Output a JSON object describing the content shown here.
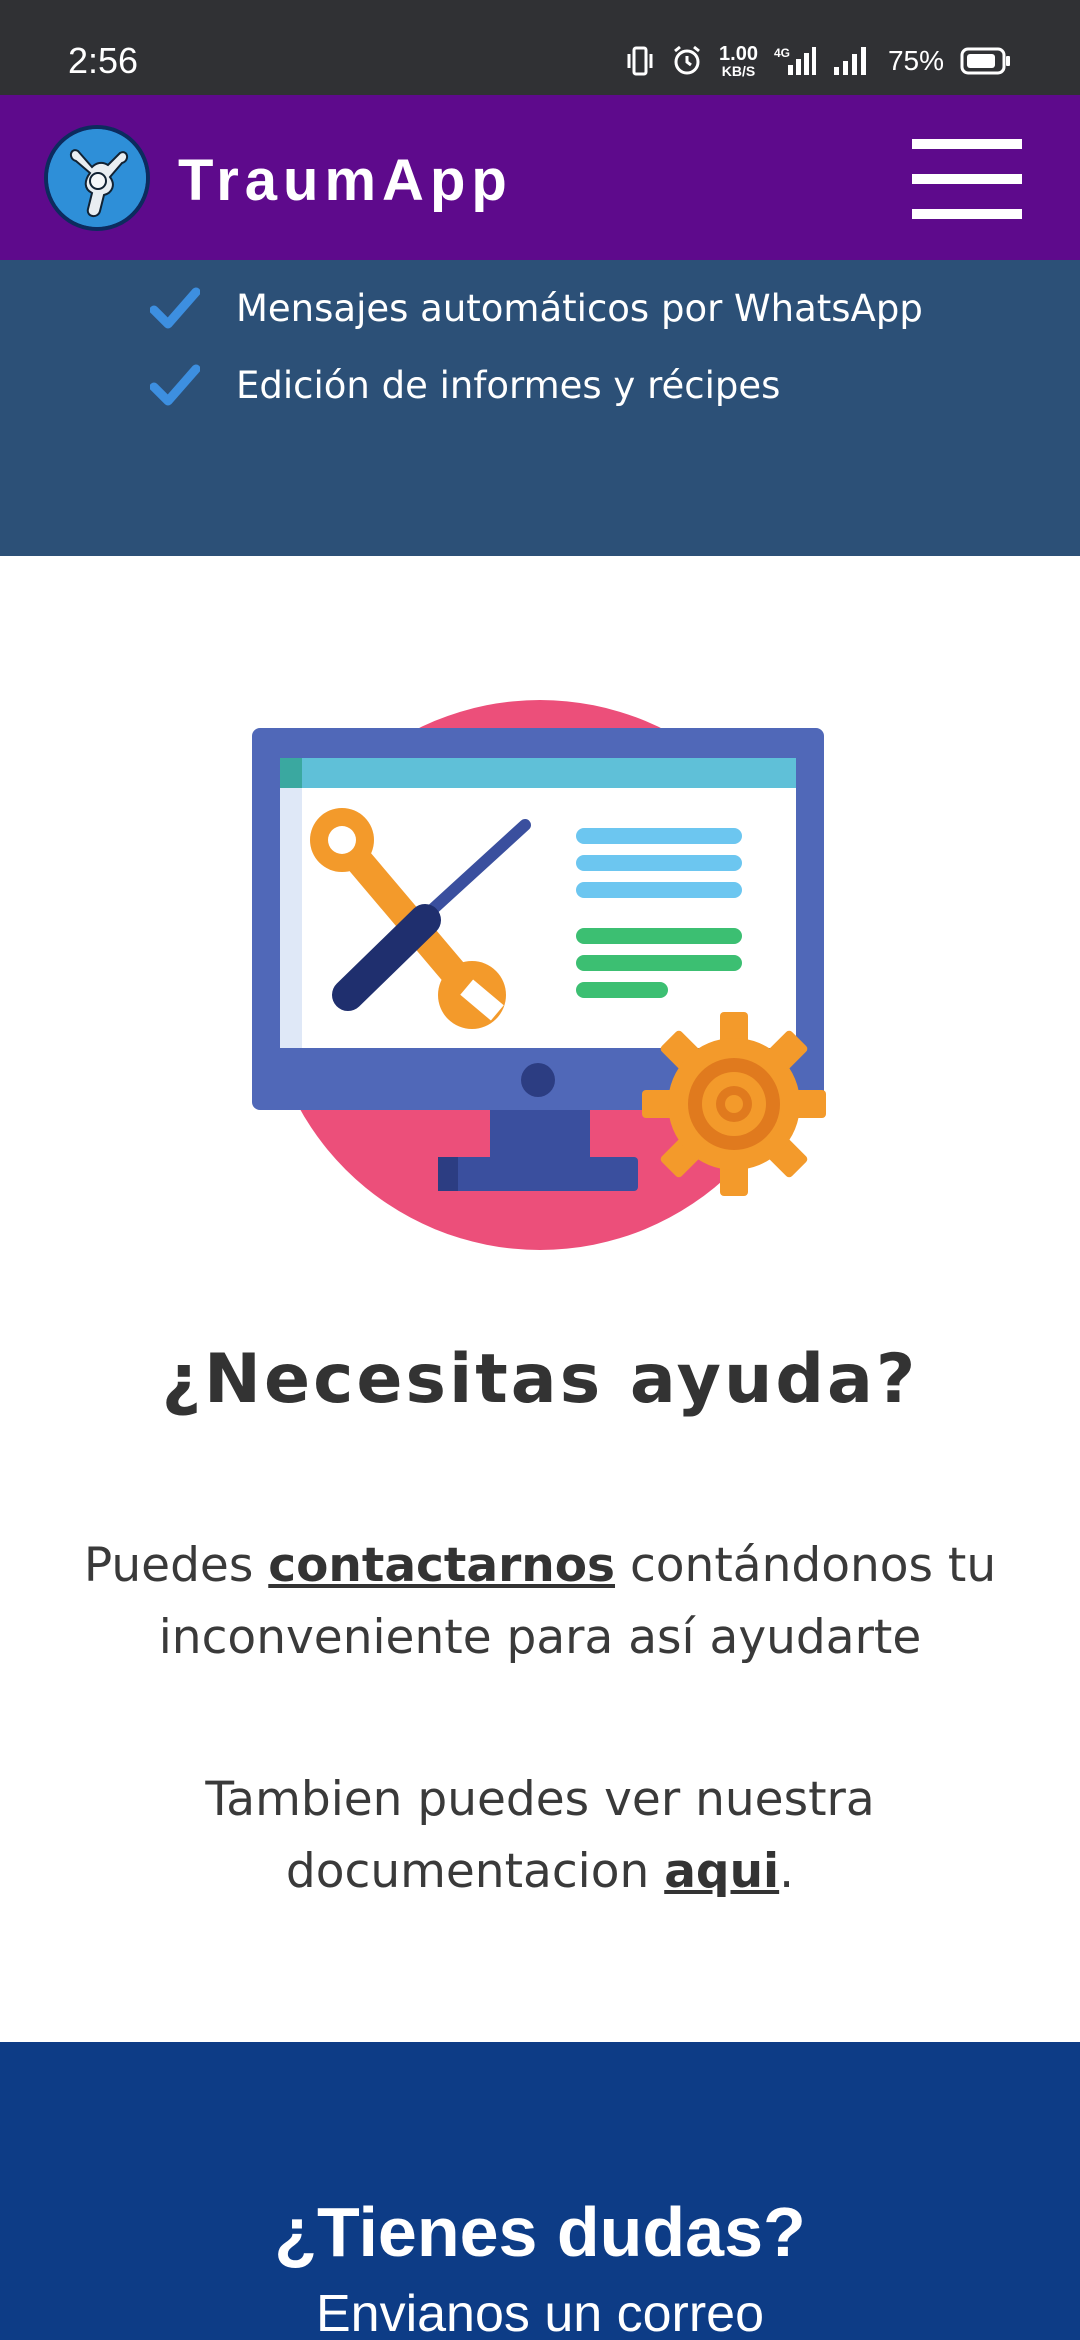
{
  "status_bar": {
    "time": "2:56",
    "net_speed_value": "1.00",
    "net_speed_unit": "KB/S",
    "network_type": "4G",
    "battery_percent": "75%",
    "icons": [
      "vibrate-icon",
      "alarm-icon",
      "signal-4g-icon",
      "signal-icon",
      "battery-icon"
    ]
  },
  "header": {
    "brand": "TraumApp",
    "logo_icon": "bone-joint-logo",
    "menu_icon": "hamburger-menu-icon",
    "background_color": "#5e0a8c"
  },
  "features": {
    "background_color": "#2c5077",
    "check_icon": "check-icon",
    "items": [
      {
        "label": "Mensajes automáticos por WhatsApp"
      },
      {
        "label": "Edición de informes y récipes"
      }
    ]
  },
  "illustration": {
    "icon": "monitor-tools-gear-illustration"
  },
  "help": {
    "title": "¿Necesitas ayuda?",
    "para1_prefix": "Puedes ",
    "para1_link": "contactarnos",
    "para1_suffix": " contándonos tu inconveniente para así ayudarte",
    "para2_prefix": "Tambien puedes ver nuestra documentacion ",
    "para2_link": "aqui",
    "para2_suffix": "."
  },
  "footer": {
    "background_color": "#0d3c86",
    "title": "¿Tienes dudas?",
    "subtitle": "Envianos un correo"
  }
}
